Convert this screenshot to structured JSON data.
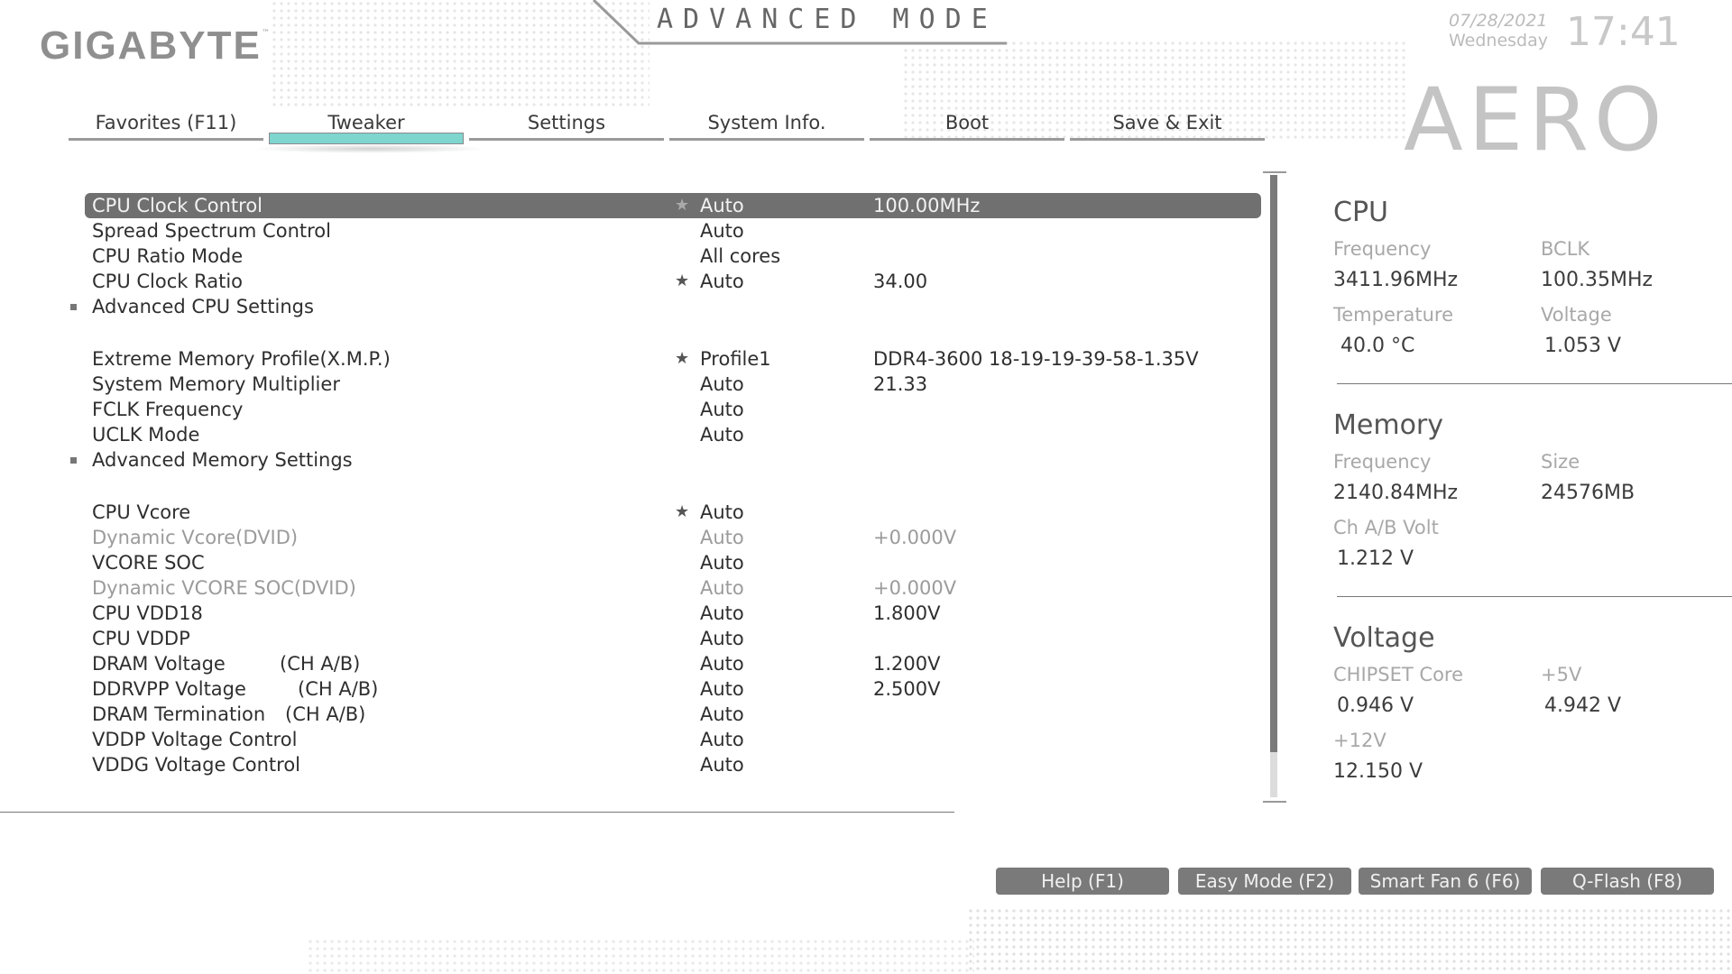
{
  "header": {
    "brand": "GIGABYTE",
    "brand_tm": "™",
    "mode_title": "ADVANCED MODE",
    "date": "07/28/2021",
    "weekday": "Wednesday",
    "time": "17:41",
    "product_logo": "AERO"
  },
  "tabs": [
    {
      "label": "Favorites (F11)",
      "active": false
    },
    {
      "label": "Tweaker",
      "active": true
    },
    {
      "label": "Settings",
      "active": false
    },
    {
      "label": "System Info.",
      "active": false
    },
    {
      "label": "Boot",
      "active": false
    },
    {
      "label": "Save & Exit",
      "active": false
    }
  ],
  "settings": [
    {
      "label": "CPU Clock Control",
      "option": "Auto",
      "value": "100.00MHz",
      "star": true,
      "selected": true
    },
    {
      "label": "Spread Spectrum Control",
      "option": "Auto",
      "value": ""
    },
    {
      "label": "CPU Ratio Mode",
      "option": "All cores",
      "value": ""
    },
    {
      "label": "CPU Clock Ratio",
      "option": "Auto",
      "value": "34.00",
      "star": true
    },
    {
      "label": "Advanced CPU Settings",
      "option": "",
      "value": "",
      "submenu": true
    },
    {
      "label": "Extreme Memory Profile(X.M.P.)",
      "option": "Profile1",
      "value": "DDR4-3600 18-19-19-39-58-1.35V",
      "star": true
    },
    {
      "label": "System Memory Multiplier",
      "option": "Auto",
      "value": "21.33"
    },
    {
      "label": "FCLK Frequency",
      "option": "Auto",
      "value": ""
    },
    {
      "label": "UCLK Mode",
      "option": "Auto",
      "value": ""
    },
    {
      "label": "Advanced Memory Settings",
      "option": "",
      "value": "",
      "submenu": true
    },
    {
      "label": "CPU Vcore",
      "option": "Auto",
      "value": "",
      "star": true
    },
    {
      "label": "Dynamic Vcore(DVID)",
      "option": "Auto",
      "value": "+0.000V",
      "dim": true
    },
    {
      "label": "VCORE SOC",
      "option": "Auto",
      "value": ""
    },
    {
      "label": "Dynamic VCORE SOC(DVID)",
      "option": "Auto",
      "value": "+0.000V",
      "dim": true
    },
    {
      "label": "CPU VDD18",
      "option": "Auto",
      "value": "1.800V"
    },
    {
      "label": "CPU VDDP",
      "option": "Auto",
      "value": ""
    },
    {
      "label": "DRAM Voltage",
      "sub": "(CH A/B)",
      "option": "Auto",
      "value": "1.200V"
    },
    {
      "label": "DDRVPP Voltage",
      "sub": "(CH A/B)",
      "option": "Auto",
      "value": "2.500V"
    },
    {
      "label": "DRAM Termination",
      "sub": "(CH A/B)",
      "option": "Auto",
      "value": ""
    },
    {
      "label": "VDDP Voltage Control",
      "option": "Auto",
      "value": ""
    },
    {
      "label": "VDDG Voltage Control",
      "option": "Auto",
      "value": ""
    }
  ],
  "hw": {
    "cpu": {
      "title": "CPU",
      "freq_label": "Frequency",
      "freq": "3411.96MHz",
      "bclk_label": "BCLK",
      "bclk": "100.35MHz",
      "temp_label": "Temperature",
      "temp": "40.0 °C",
      "volt_label": "Voltage",
      "volt": "1.053 V"
    },
    "memory": {
      "title": "Memory",
      "freq_label": "Frequency",
      "freq": "2140.84MHz",
      "size_label": "Size",
      "size": "24576MB",
      "volt_label": "Ch A/B Volt",
      "volt": "1.212 V"
    },
    "voltage": {
      "title": "Voltage",
      "chipset_label": "CHIPSET Core",
      "chipset": "0.946 V",
      "v5_label": "+5V",
      "v5": "4.942 V",
      "v12_label": "+12V",
      "v12": "12.150 V"
    }
  },
  "footer": {
    "help": "Help (F1)",
    "easy": "Easy Mode (F2)",
    "smartfan": "Smart Fan 6 (F6)",
    "qflash": "Q-Flash (F8)"
  },
  "colors": {
    "tab_active": "#7ed6cf",
    "selected_row": "#707070",
    "button": "#7a7a7a"
  }
}
